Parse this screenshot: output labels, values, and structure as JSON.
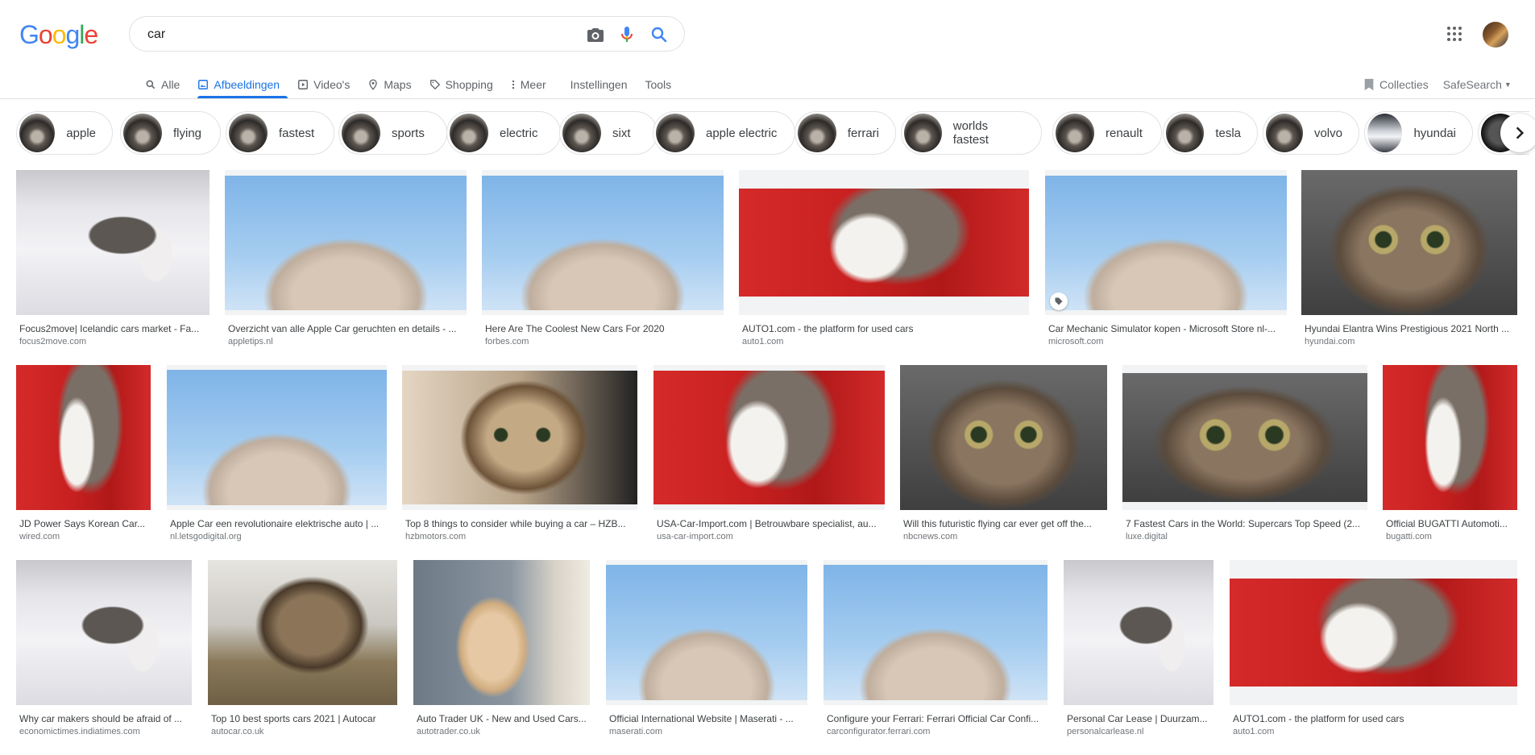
{
  "logo": "Google",
  "search": {
    "query": "car"
  },
  "tabs": [
    {
      "label": "Alle",
      "icon": "search-icon"
    },
    {
      "label": "Afbeeldingen",
      "icon": "image-icon",
      "active": true
    },
    {
      "label": "Video's",
      "icon": "play-icon"
    },
    {
      "label": "Maps",
      "icon": "map-pin-icon"
    },
    {
      "label": "Shopping",
      "icon": "tag-icon"
    },
    {
      "label": "Meer",
      "icon": "more-vert-icon"
    },
    {
      "label": "Instellingen"
    },
    {
      "label": "Tools"
    }
  ],
  "header_right": {
    "collections": "Collecties",
    "safesearch": "SafeSearch"
  },
  "chips": [
    "apple",
    "flying",
    "fastest",
    "sports",
    "electric",
    "sixt",
    "apple electric",
    "ferrari",
    "worlds fastest",
    "renault",
    "tesla",
    "volvo",
    "hyundai"
  ],
  "results": [
    {
      "title": "Focus2move| Icelandic cars market - Fa...",
      "source": "focus2move.com"
    },
    {
      "title": "Overzicht van alle Apple Car geruchten en details - ...",
      "source": "appletips.nl"
    },
    {
      "title": "Here Are The Coolest New Cars For 2020",
      "source": "forbes.com"
    },
    {
      "title": "AUTO1.com - the platform for used cars",
      "source": "auto1.com"
    },
    {
      "title": "Car Mechanic Simulator kopen - Microsoft Store nl-...",
      "source": "microsoft.com"
    },
    {
      "title": "Hyundai Elantra Wins Prestigious 2021 North ...",
      "source": "hyundai.com"
    },
    {
      "title": "JD Power Says Korean Car...",
      "source": "wired.com"
    },
    {
      "title": "Apple Car een revolutionaire elektrische auto | ...",
      "source": "nl.letsgodigital.org"
    },
    {
      "title": "Top 8 things to consider while buying a car – HZB...",
      "source": "hzbmotors.com"
    },
    {
      "title": "USA-Car-Import.com | Betrouwbare specialist, au...",
      "source": "usa-car-import.com"
    },
    {
      "title": "Will this futuristic flying car ever get off the...",
      "source": "nbcnews.com"
    },
    {
      "title": "7 Fastest Cars in the World: Supercars Top Speed (2...",
      "source": "luxe.digital"
    },
    {
      "title": "Official BUGATTI Automoti...",
      "source": "bugatti.com"
    },
    {
      "title": "Why car makers should be afraid of ...",
      "source": "economictimes.indiatimes.com"
    },
    {
      "title": "Top 10 best sports cars 2021 | Autocar",
      "source": "autocar.co.uk"
    },
    {
      "title": "Auto Trader UK - New and Used Cars...",
      "source": "autotrader.co.uk"
    },
    {
      "title": "Official International Website | Maserati - ...",
      "source": "maserati.com"
    },
    {
      "title": "Configure your Ferrari: Ferrari Official Car Confi...",
      "source": "carconfigurator.ferrari.com"
    },
    {
      "title": "Personal Car Lease | Duurzam...",
      "source": "personalcarlease.nl"
    },
    {
      "title": "AUTO1.com - the platform for used cars",
      "source": "auto1.com"
    }
  ]
}
